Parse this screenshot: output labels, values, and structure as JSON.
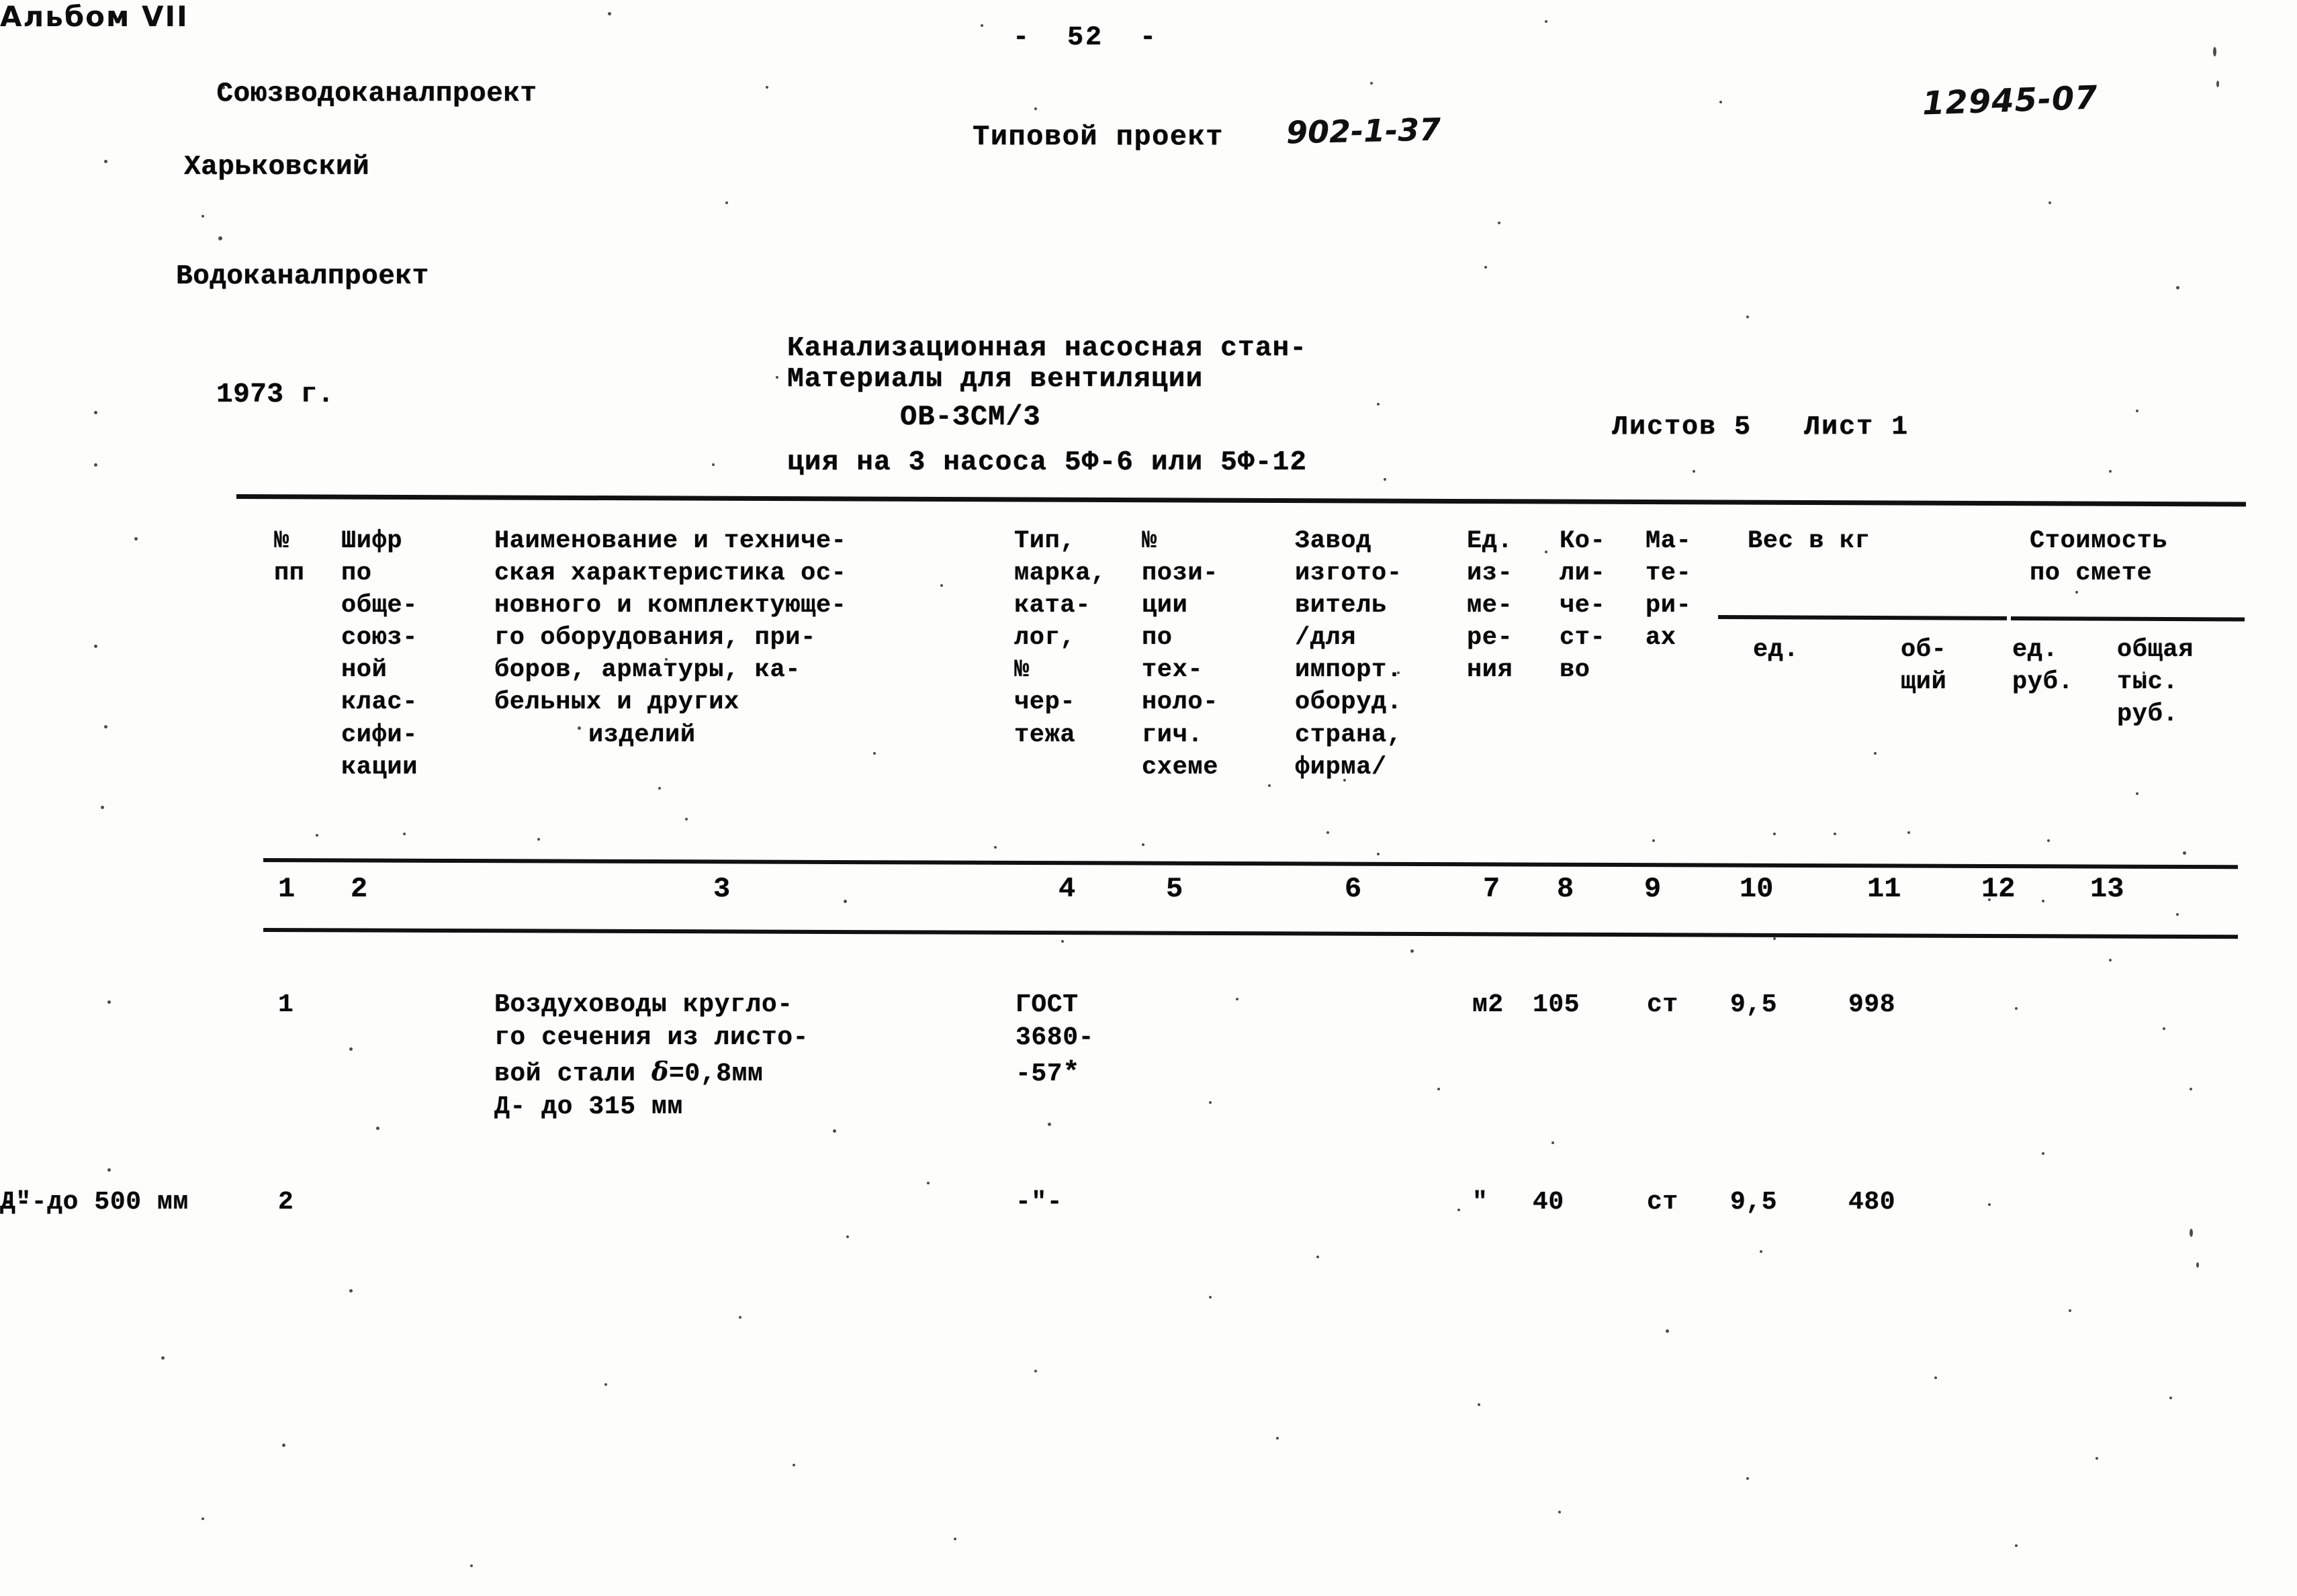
{
  "header": {
    "org_line1": "Союзводоканалпроект",
    "org_line2": "Харьковский",
    "org_line3": "Водоканалпроект",
    "org_year": "1973 г.",
    "page_number": "-  52  -",
    "project_label": "Типовой проект",
    "project_code": "902-1-37",
    "doc_number": "12945-07",
    "title_line1": "Канализационная насосная стан-",
    "title_line2": "ция на 3 насоса 5Ф-6 или 5Ф-12",
    "album": "Альбом VII",
    "materials": "Материалы для вентиляции",
    "ov_code": "ОВ-ЗСМ/3",
    "sheets_total": "Листов 5",
    "sheet_current": "Лист 1"
  },
  "table": {
    "headers": {
      "col1": "№\nпп",
      "col2": "Шифр\nпо\nобще-\nсоюз-\nной\nклас-\nсифи-\nкации",
      "col3_lines": "Наименование и техниче-\nская характеристика ос-\nновного и комплектующе-\nго оборудования, при-\nборов, арматуры, ка-\nбельных и других",
      "col3_last": "изделий",
      "col4": "Тип,\nмарка,\nката-\nлог,\n№\nчер-\nтежа",
      "col5": "№\nпози-\nции\nпо\nтех-\nноло-\nгич.\nсхеме",
      "col6": "Завод\nизгото-\nвитель\n/для\nимпорт.\nоборуд.\nстрана,\nфирма/",
      "col7": "Ед.\nиз-\nме-\nре-\nния",
      "col8": "Ко-\nли-\nче-\nст-\nво",
      "col9": "Ма-\nте-\nри-\nах",
      "col10_group": "Вес в кг",
      "col11_group": "Стоимость\nпо смете",
      "col10": "ед.",
      "col11": "об-\nщий",
      "col12": "ед.\nруб.",
      "col13": "общая\nтыс.\nруб."
    },
    "column_numbers": [
      "1",
      "2",
      "3",
      "4",
      "5",
      "6",
      "7",
      "8",
      "9",
      "10",
      "11",
      "12",
      "13"
    ],
    "rows": [
      {
        "num": "1",
        "code": "",
        "name": "Воздуховоды кругло-\nго сечения из листо-\nвой стали",
        "name_delta": "δ",
        "name_thickness": "=0,8мм",
        "name_diameter": "Д- до 315 мм",
        "type": "ГОСТ\n3680-\n-57",
        "type_star": "*",
        "position": "",
        "manufacturer": "",
        "unit": "м2",
        "quantity": "105",
        "material": "ст",
        "weight_unit": "9,5",
        "weight_total": "998",
        "cost_unit": "",
        "cost_total": ""
      },
      {
        "num": "2",
        "code": "",
        "name_ditto": "-\"-",
        "name": "Д- до 500 мм",
        "type": "-\"-",
        "position": "",
        "manufacturer": "",
        "unit": "\"",
        "quantity": "40",
        "material": "ст",
        "weight_unit": "9,5",
        "weight_total": "480",
        "cost_unit": "",
        "cost_total": ""
      }
    ]
  }
}
